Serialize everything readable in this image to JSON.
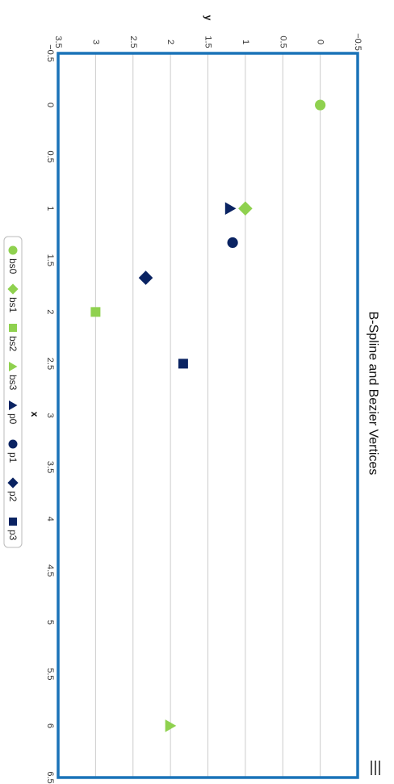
{
  "chart_data": {
    "type": "scatter",
    "title": "B-Spline and Bezier Vertices",
    "xlabel": "x",
    "ylabel": "y",
    "xlim": [
      -0.5,
      6.5
    ],
    "ylim": [
      -0.5,
      3.5
    ],
    "x_ticks": [
      -0.5,
      0,
      0.5,
      1,
      1.5,
      2,
      2.5,
      3,
      3.5,
      4,
      4.5,
      5,
      5.5,
      6,
      6.5
    ],
    "y_ticks": [
      -0.5,
      0,
      0.5,
      1,
      1.5,
      2,
      2.5,
      3,
      3.5
    ],
    "x_tick_labels": [
      "−0.5",
      "0",
      "0.5",
      "1",
      "1.5",
      "2",
      "2.5",
      "3",
      "3.5",
      "4",
      "4.5",
      "5",
      "5.5",
      "6",
      "6.5"
    ],
    "y_tick_labels": [
      "−0.5",
      "0",
      "0.5",
      "1",
      "1.5",
      "2",
      "2.5",
      "3",
      "3.5"
    ],
    "grid": true,
    "legend_position": "bottom",
    "series": [
      {
        "name": "bs0",
        "marker": "circle",
        "color": "#8fd14f",
        "points": [
          [
            0,
            0
          ]
        ]
      },
      {
        "name": "bs1",
        "marker": "diamond",
        "color": "#8fd14f",
        "points": [
          [
            1,
            1
          ]
        ]
      },
      {
        "name": "bs2",
        "marker": "square",
        "color": "#8fd14f",
        "points": [
          [
            2,
            3
          ]
        ]
      },
      {
        "name": "bs3",
        "marker": "triangle",
        "color": "#8fd14f",
        "points": [
          [
            6,
            2
          ]
        ]
      },
      {
        "name": "p0",
        "marker": "triangle",
        "color": "#0a2362",
        "points": [
          [
            1,
            1.2
          ]
        ]
      },
      {
        "name": "p1",
        "marker": "circle",
        "color": "#0a2362",
        "points": [
          [
            1.33,
            1.17
          ]
        ]
      },
      {
        "name": "p2",
        "marker": "diamond",
        "color": "#0a2362",
        "points": [
          [
            1.67,
            2.33
          ]
        ]
      },
      {
        "name": "p3",
        "marker": "square",
        "color": "#0a2362",
        "points": [
          [
            2.5,
            1.83
          ]
        ]
      }
    ]
  },
  "colors": {
    "plot_border": "#1a73b8",
    "grid": "#cccccc",
    "green": "#8fd14f",
    "navy": "#0a2362"
  },
  "menu_icon": "hamburger-menu-icon"
}
